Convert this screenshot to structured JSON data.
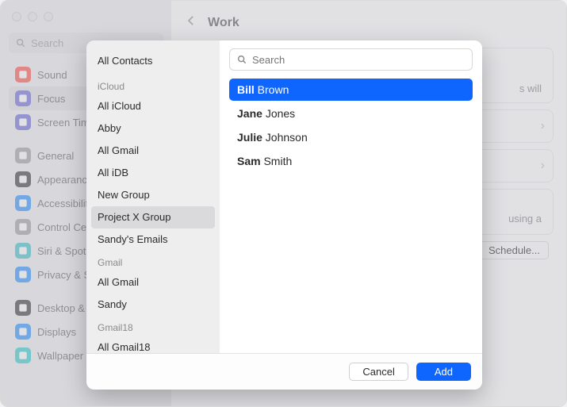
{
  "window": {
    "search_placeholder": "Search",
    "sidebar": [
      {
        "label": "Sound",
        "color": "#ff3b30"
      },
      {
        "label": "Focus",
        "color": "#5856d6",
        "selected": true
      },
      {
        "label": "Screen Time",
        "color": "#5856d6"
      }
    ],
    "sidebar2": [
      {
        "label": "General",
        "color": "#8e8e93"
      },
      {
        "label": "Appearance",
        "color": "#1c1c1e"
      },
      {
        "label": "Accessibility",
        "color": "#0a84ff"
      },
      {
        "label": "Control Center",
        "color": "#8e8e93"
      },
      {
        "label": "Siri & Spotlight",
        "color": "#1fb6c1"
      },
      {
        "label": "Privacy & Security",
        "color": "#0a84ff"
      }
    ],
    "sidebar3": [
      {
        "label": "Desktop & Dock",
        "color": "#1c1c1e"
      },
      {
        "label": "Displays",
        "color": "#0a84ff"
      },
      {
        "label": "Wallpaper",
        "color": "#16c6c6"
      }
    ]
  },
  "header": {
    "title": "Work"
  },
  "fragments": {
    "will": "s will",
    "using": "using a",
    "schedule": "Schedule..."
  },
  "modal": {
    "search_placeholder": "Search",
    "all_contacts": "All Contacts",
    "groups": [
      {
        "header": "iCloud",
        "items": [
          "All iCloud",
          "Abby",
          "All Gmail",
          "All iDB",
          "New Group",
          "Project X Group",
          "Sandy's Emails"
        ],
        "selected": "Project X Group"
      },
      {
        "header": "Gmail",
        "items": [
          "All Gmail",
          "Sandy"
        ]
      },
      {
        "header": "Gmail18",
        "items": [
          "All Gmail18"
        ]
      }
    ],
    "contacts": [
      {
        "first": "Bill",
        "last": "Brown",
        "selected": true
      },
      {
        "first": "Jane",
        "last": "Jones"
      },
      {
        "first": "Julie",
        "last": "Johnson"
      },
      {
        "first": "Sam",
        "last": "Smith"
      }
    ],
    "cancel": "Cancel",
    "add": "Add"
  }
}
